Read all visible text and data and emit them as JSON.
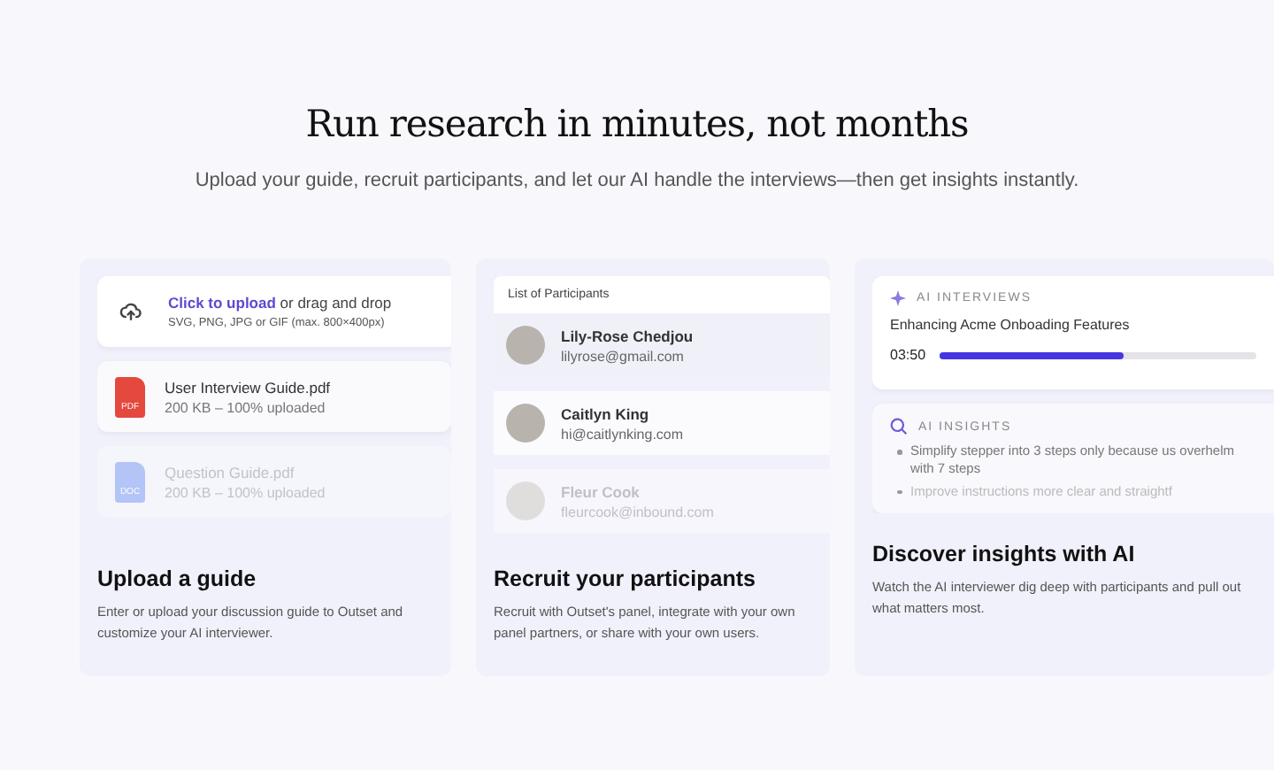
{
  "heading": "Run research in minutes, not months",
  "subheading": "Upload your guide, recruit participants, and let our AI handle the interviews—then get insights instantly.",
  "upload_card": {
    "dropzone": {
      "link": "Click to upload",
      "text": "or drag and drop",
      "hint": "SVG, PNG, JPG or GIF (max. 800×400px)"
    },
    "files": [
      {
        "name": "User Interview Guide.pdf",
        "status": "200 KB – 100% uploaded",
        "badge": "PDF",
        "color": "#e5483d"
      },
      {
        "name": "Question Guide.pdf",
        "status": "200 KB – 100% uploaded",
        "badge": "DOC",
        "color": "#b3c4f6"
      }
    ],
    "title": "Upload a guide",
    "text": "Enter or upload your discussion guide to Outset and customize your AI interviewer."
  },
  "participants_card": {
    "list_title": "List of Participants",
    "participants": [
      {
        "name": "Lily-Rose Chedjou",
        "email": "lilyrose@gmail.com"
      },
      {
        "name": "Caitlyn King",
        "email": "hi@caitlynking.com"
      },
      {
        "name": "Fleur Cook",
        "email": "fleurcook@inbound.com"
      }
    ],
    "title": "Recruit your participants",
    "text": "Recruit with Outset's panel, integrate with your own panel partners, or share with your own users."
  },
  "insights_card": {
    "interviews_label": "AI INTERVIEWS",
    "interview_title": "Enhancing Acme Onboading Features",
    "time": "03:50",
    "level": 0.58,
    "insights_label": "AI INSIGHTS",
    "insights": [
      "Simplify stepper into 3 steps only because us overhelm with 7 steps",
      "Improve instructions more clear and straightf"
    ],
    "title": "Discover insights with AI",
    "text": "Watch the AI interviewer dig deep with participants and pull out what matters most."
  }
}
